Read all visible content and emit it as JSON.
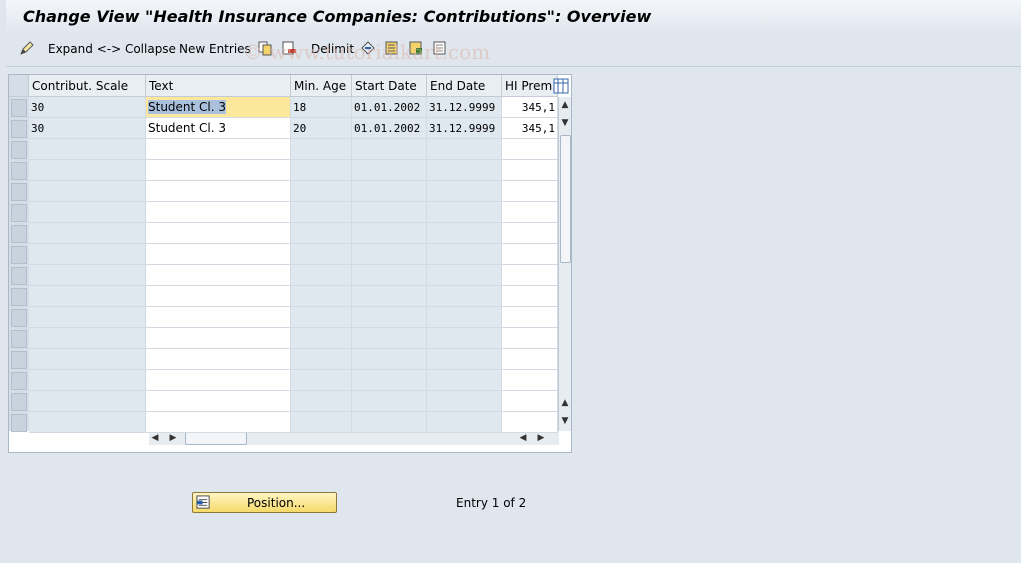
{
  "window": {
    "title": "Change View \"Health Insurance Companies: Contributions\": Overview"
  },
  "toolbar": {
    "expand_collapse": "Expand <-> Collapse",
    "new_entries": "New Entries",
    "delimit": "Delimit"
  },
  "watermark": "© www.tutorialkart.com",
  "table": {
    "columns": [
      "Contribut. Scale",
      "Text",
      "Min. Age",
      "Start Date",
      "End Date",
      "HI Prem."
    ],
    "rows": [
      {
        "scale": "30",
        "text": "Student Cl. 3",
        "min_age": "18",
        "start": "01.01.2002",
        "end": "31.12.9999",
        "prem": "345,1"
      },
      {
        "scale": "30",
        "text": "Student Cl. 3",
        "min_age": "20",
        "start": "01.01.2002",
        "end": "31.12.9999",
        "prem": "345,1"
      }
    ]
  },
  "footer": {
    "position_button": "Position...",
    "entry_info": "Entry 1 of 2"
  },
  "colors": {
    "focus_cell": "#fde79b",
    "button": "#f5d96a"
  }
}
